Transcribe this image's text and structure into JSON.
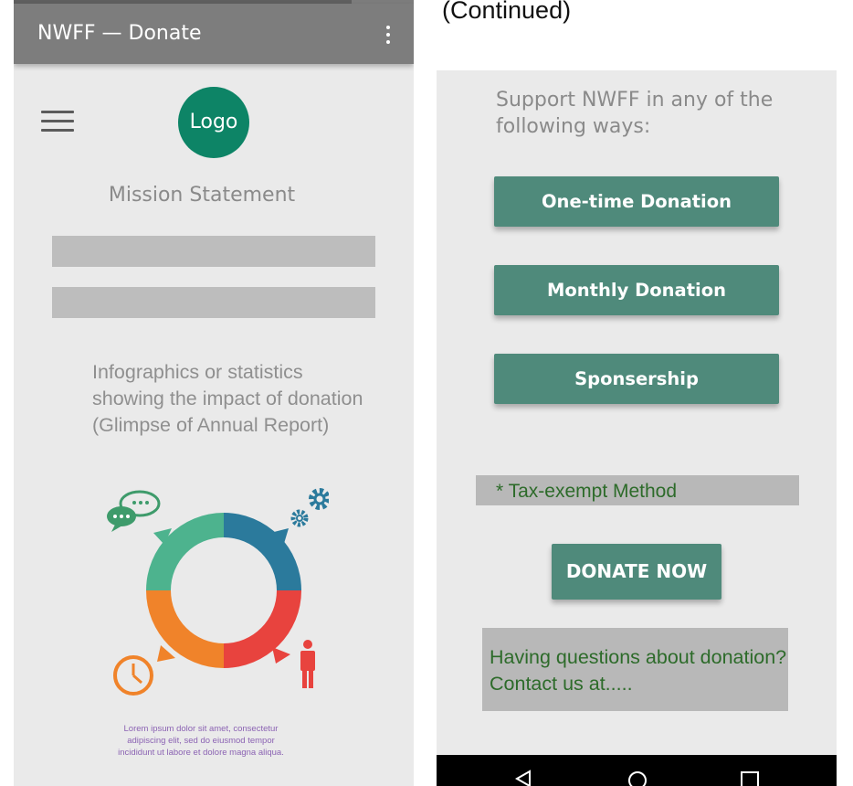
{
  "left_screen": {
    "app_title": "NWFF — Donate",
    "logo_text": "Logo",
    "mission_text": "Mission Statement",
    "infographic_text": "Infographics or statistics showing the impact of donation (Glimpse of Annual Report)",
    "lorem_text": "Lorem ipsum dolor sit amet, consectetur adipiscing elit, sed do eiusmod tempor incididunt ut labore et dolore magna aliqua.",
    "infographic_colors": [
      "#4db38e",
      "#2b7a9c",
      "#e8433e",
      "#f0832a"
    ],
    "infographic_icons": [
      "chat-bubbles-icon",
      "gears-icon",
      "clock-icon",
      "person-icon"
    ]
  },
  "caption": "(Continued)",
  "right_screen": {
    "support_text": "Support NWFF in any of the following ways:",
    "buttons": [
      "One-time Donation",
      "Monthly Donation",
      "Sponsership"
    ],
    "tax_text": "* Tax-exempt Method",
    "donate_now": "DONATE NOW",
    "contact_text": "Having questions about donation? Contact us at.....",
    "nav_icons": [
      "back-icon",
      "home-icon",
      "recents-icon"
    ]
  },
  "colors": {
    "app_bar": "#7d7d7d",
    "logo": "#0d8466",
    "button": "#4f8a7b",
    "green_text": "#2d6b2a"
  }
}
